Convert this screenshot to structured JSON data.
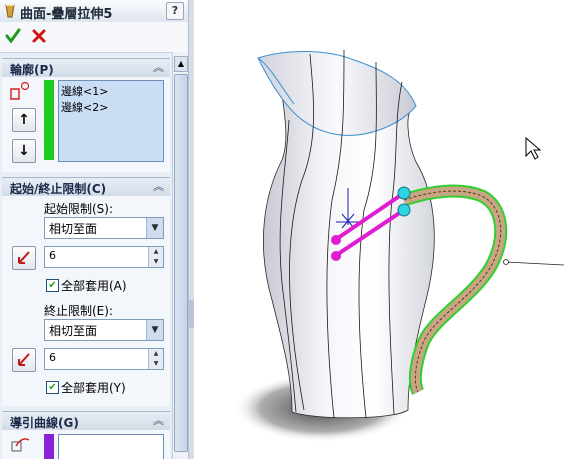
{
  "panel": {
    "title": "曲面-疊層拉伸5",
    "help_label": "?",
    "actions": {
      "ok_icon": "check-icon",
      "cancel_icon": "x-icon"
    },
    "profiles": {
      "header": "輪廓(P)",
      "items": [
        "邊線<1>",
        "邊線<2>"
      ],
      "move_up_label": "↑",
      "move_down_label": "↓"
    },
    "constraints": {
      "header": "起始/終止限制(C)",
      "start_label": "起始限制(S):",
      "start_value": "相切至面",
      "start_length": "6",
      "start_apply_all": "全部套用(A)",
      "start_apply_all_checked": true,
      "end_label": "終止限制(E):",
      "end_value": "相切至面",
      "end_length": "6",
      "end_apply_all": "全部套用(Y)",
      "end_apply_all_checked": true
    },
    "guides": {
      "header": "導引曲線(G)"
    }
  },
  "colors": {
    "profile_bar": "#1ecb1e",
    "guide_bar": "#8a22d6",
    "connector": "#e11bd1",
    "handle": "#2dd3e3",
    "guide_curve": "#30d030"
  }
}
